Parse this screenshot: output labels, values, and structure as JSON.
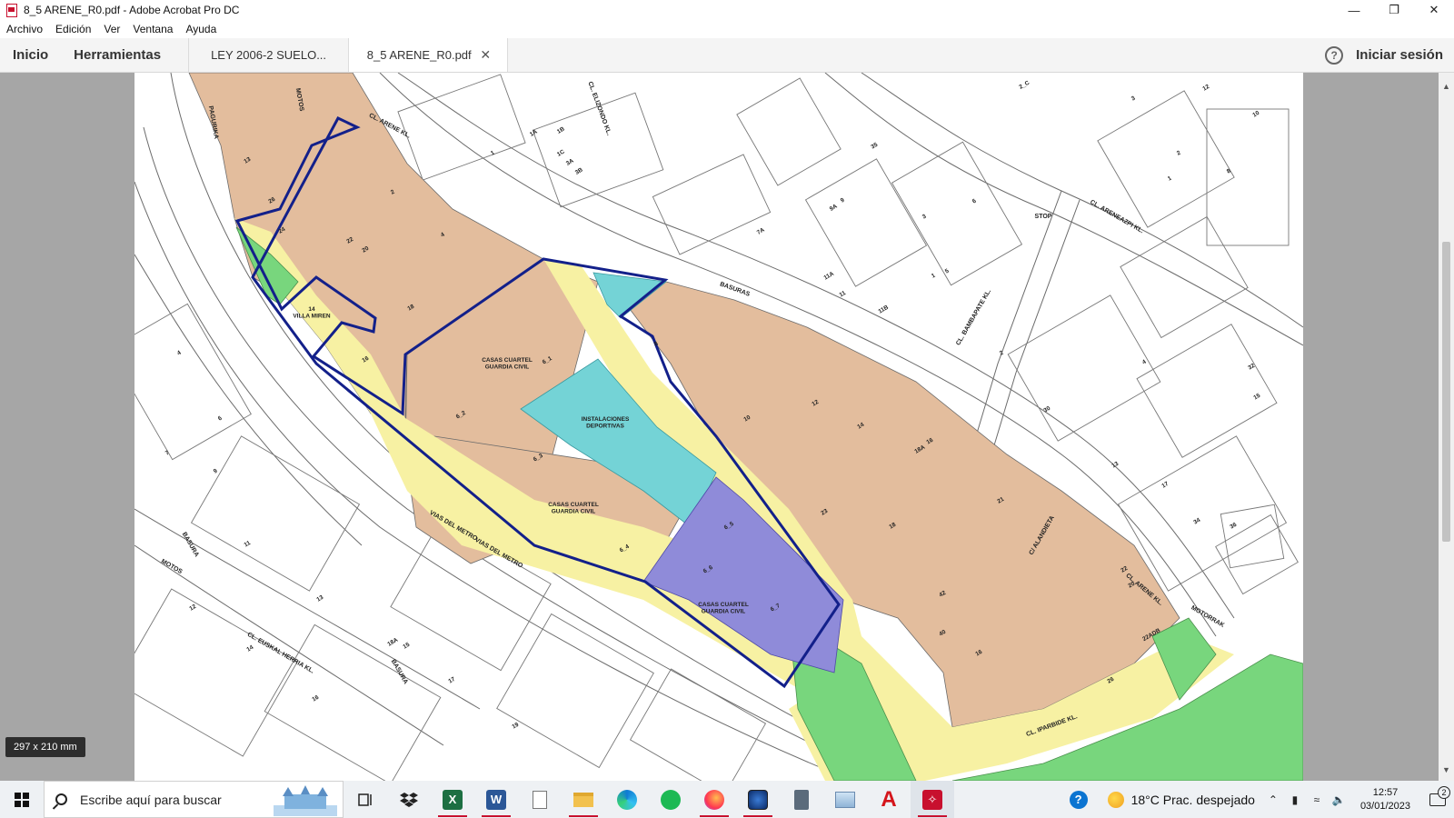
{
  "window": {
    "title": "8_5 ARENE_R0.pdf - Adobe Acrobat Pro DC"
  },
  "menu": [
    "Archivo",
    "Edición",
    "Ver",
    "Ventana",
    "Ayuda"
  ],
  "toolbar": {
    "home_label": "Inicio",
    "tools_label": "Herramientas",
    "tabs": [
      {
        "label": "LEY 2006-2 SUELO..."
      },
      {
        "label": "8_5 ARENE_R0.pdf"
      }
    ],
    "signin_label": "Iniciar sesión"
  },
  "page_size": "297 x 210 mm",
  "map": {
    "colors": {
      "residential": "#e3bd9d",
      "yellow": "#f7f1a3",
      "cyan": "#74d3d6",
      "violet": "#8f8bd9",
      "green": "#78d67d",
      "outline": "#13208a",
      "lines": "#6b6b6b"
    },
    "streets": [
      "CL. ARENE KL.",
      "CL. ELIZONDO KL.",
      "CL. ARENEAZPI KL.",
      "CL. BAMBAPATE KL.",
      "C/ ALANDIETA",
      "CL. IPARBIDE KL.",
      "VIAS DEL METRO",
      "VIAS DEL METRO",
      "CL. EUSKAL HERRIA KL.",
      "BASURAS",
      "BASURA",
      "BASURA",
      "MOTOS",
      "MOTOS",
      "MOTORRAK",
      "STOP",
      "CL. ARENE KL.",
      "PAGURIKA"
    ],
    "places": [
      "CASAS CUARTEL\nGUARDIA CIVIL",
      "INSTALACIONES\nDEPORTIVAS",
      "CASAS CUARTEL\nGUARDIA CIVIL",
      "CASAS CUARTEL\nGUARDIA CIVIL",
      "14\nVILLA MIREN"
    ],
    "lots": [
      "6_1",
      "6_2",
      "6_3",
      "6_4",
      "6_5",
      "6_6",
      "6_7",
      "2_C"
    ],
    "numbers": [
      "13",
      "26",
      "24",
      "22",
      "20",
      "2",
      "4",
      "18",
      "16",
      "8",
      "10",
      "12",
      "14",
      "16",
      "18A",
      "18",
      "21",
      "23",
      "22",
      "20",
      "26",
      "42",
      "40",
      "16",
      "22ADB",
      "35",
      "9",
      "9A",
      "7A",
      "11A",
      "11",
      "11B",
      "3",
      "5",
      "1",
      "6",
      "4",
      "2",
      "30",
      "32",
      "15",
      "13",
      "17",
      "34",
      "36",
      "12",
      "10",
      "8",
      "1",
      "11",
      "13",
      "9",
      "7",
      "12",
      "14",
      "16",
      "17",
      "19",
      "18A",
      "15",
      "4",
      "6",
      "3",
      "1A",
      "1B",
      "1C",
      "3A",
      "3B",
      "1",
      "2"
    ]
  },
  "taskbar": {
    "search_placeholder": "Escribe aquí para buscar",
    "weather": "18°C  Prac. despejado",
    "time": "12:57",
    "date": "03/01/2023",
    "notifications": "2"
  }
}
